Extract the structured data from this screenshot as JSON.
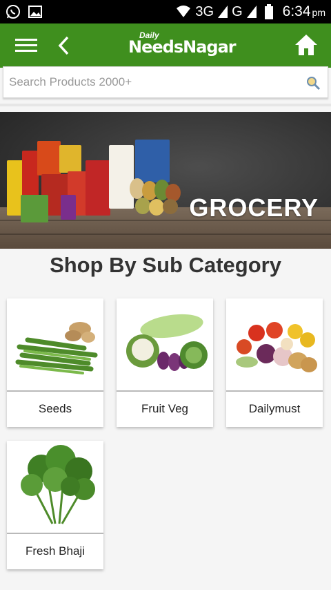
{
  "status_bar": {
    "network_label": "3G",
    "network2_label": "G",
    "time": "6:34",
    "ampm": "pm",
    "icons": [
      "whatsapp-icon",
      "image-icon",
      "wifi-icon",
      "signal-icon",
      "battery-icon"
    ]
  },
  "app_bar": {
    "logo_small": "Daily",
    "logo_main": "NeedsNagar",
    "color": "#3f8f1e",
    "icons": [
      "menu-icon",
      "back-arrow-icon",
      "home-icon"
    ]
  },
  "search": {
    "placeholder": "Search Products 2000+",
    "icon": "search-icon"
  },
  "banner": {
    "title": "GROCERY"
  },
  "section": {
    "title": "Shop By Sub Category"
  },
  "subcategories": [
    {
      "label": "Seeds"
    },
    {
      "label": "Fruit Veg"
    },
    {
      "label": "Dailymust"
    },
    {
      "label": "Fresh Bhaji"
    }
  ]
}
